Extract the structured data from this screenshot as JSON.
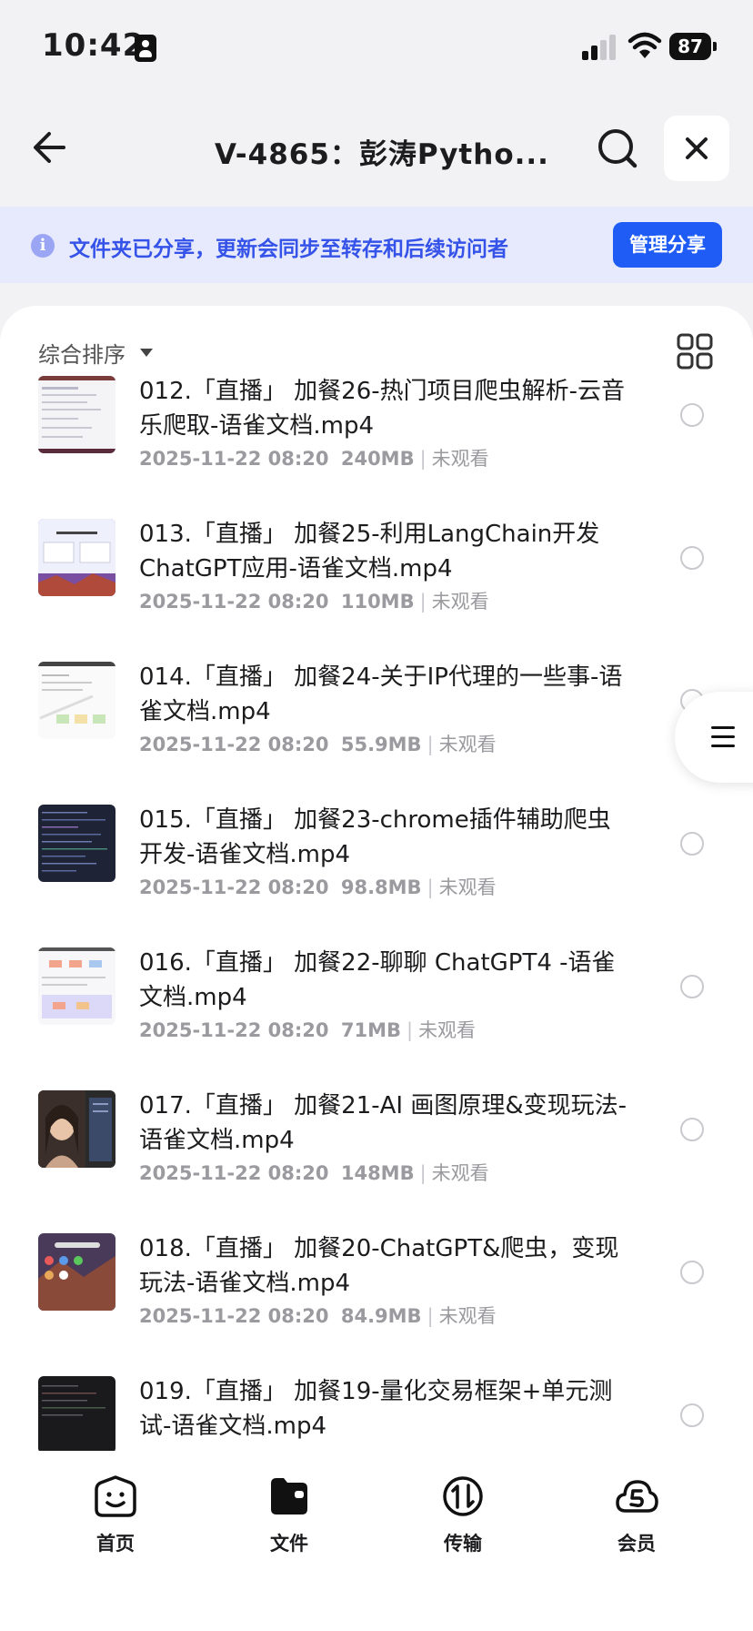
{
  "status_bar": {
    "time": "10:42",
    "battery": "87"
  },
  "nav": {
    "title": "V-4865：彭涛Pytho..."
  },
  "banner": {
    "text": "文件夹已分享，更新会同步至转存和后续访问者",
    "manage_label": "管理分享",
    "accent": "#1f5cf5"
  },
  "toolbar": {
    "sort_label": "综合排序"
  },
  "files": [
    {
      "name": "012.「直播」 加餐26-热门项目爬虫解析-云音乐爬取-语雀文档.mp4",
      "date": "2025-11-22 08:20",
      "size": "240MB",
      "status": "未观看"
    },
    {
      "name": "013.「直播」 加餐25-利用LangChain开发ChatGPT应用-语雀文档.mp4",
      "date": "2025-11-22 08:20",
      "size": "110MB",
      "status": "未观看"
    },
    {
      "name": "014.「直播」 加餐24-关于IP代理的一些事-语雀文档.mp4",
      "date": "2025-11-22 08:20",
      "size": "55.9MB",
      "status": "未观看"
    },
    {
      "name": "015.「直播」 加餐23-chrome插件辅助爬虫开发-语雀文档.mp4",
      "date": "2025-11-22 08:20",
      "size": "98.8MB",
      "status": "未观看"
    },
    {
      "name": "016.「直播」 加餐22-聊聊 ChatGPT4 -语雀文档.mp4",
      "date": "2025-11-22 08:20",
      "size": "71MB",
      "status": "未观看"
    },
    {
      "name": "017.「直播」 加餐21-AI 画图原理&变现玩法-语雀文档.mp4",
      "date": "2025-11-22 08:20",
      "size": "148MB",
      "status": "未观看"
    },
    {
      "name": "018.「直播」 加餐20-ChatGPT&爬虫，变现玩法-语雀文档.mp4",
      "date": "2025-11-22 08:20",
      "size": "84.9MB",
      "status": "未观看"
    },
    {
      "name": "019.「直播」 加餐19-量化交易框架+单元测试-语雀文档.mp4",
      "date": "",
      "size": "",
      "status": ""
    }
  ],
  "tabs": [
    {
      "label": "首页",
      "icon": "smiley-home-icon"
    },
    {
      "label": "文件",
      "icon": "folder-icon"
    },
    {
      "label": "传输",
      "icon": "transfer-icon"
    },
    {
      "label": "会员",
      "icon": "vip-cloud-icon"
    }
  ]
}
